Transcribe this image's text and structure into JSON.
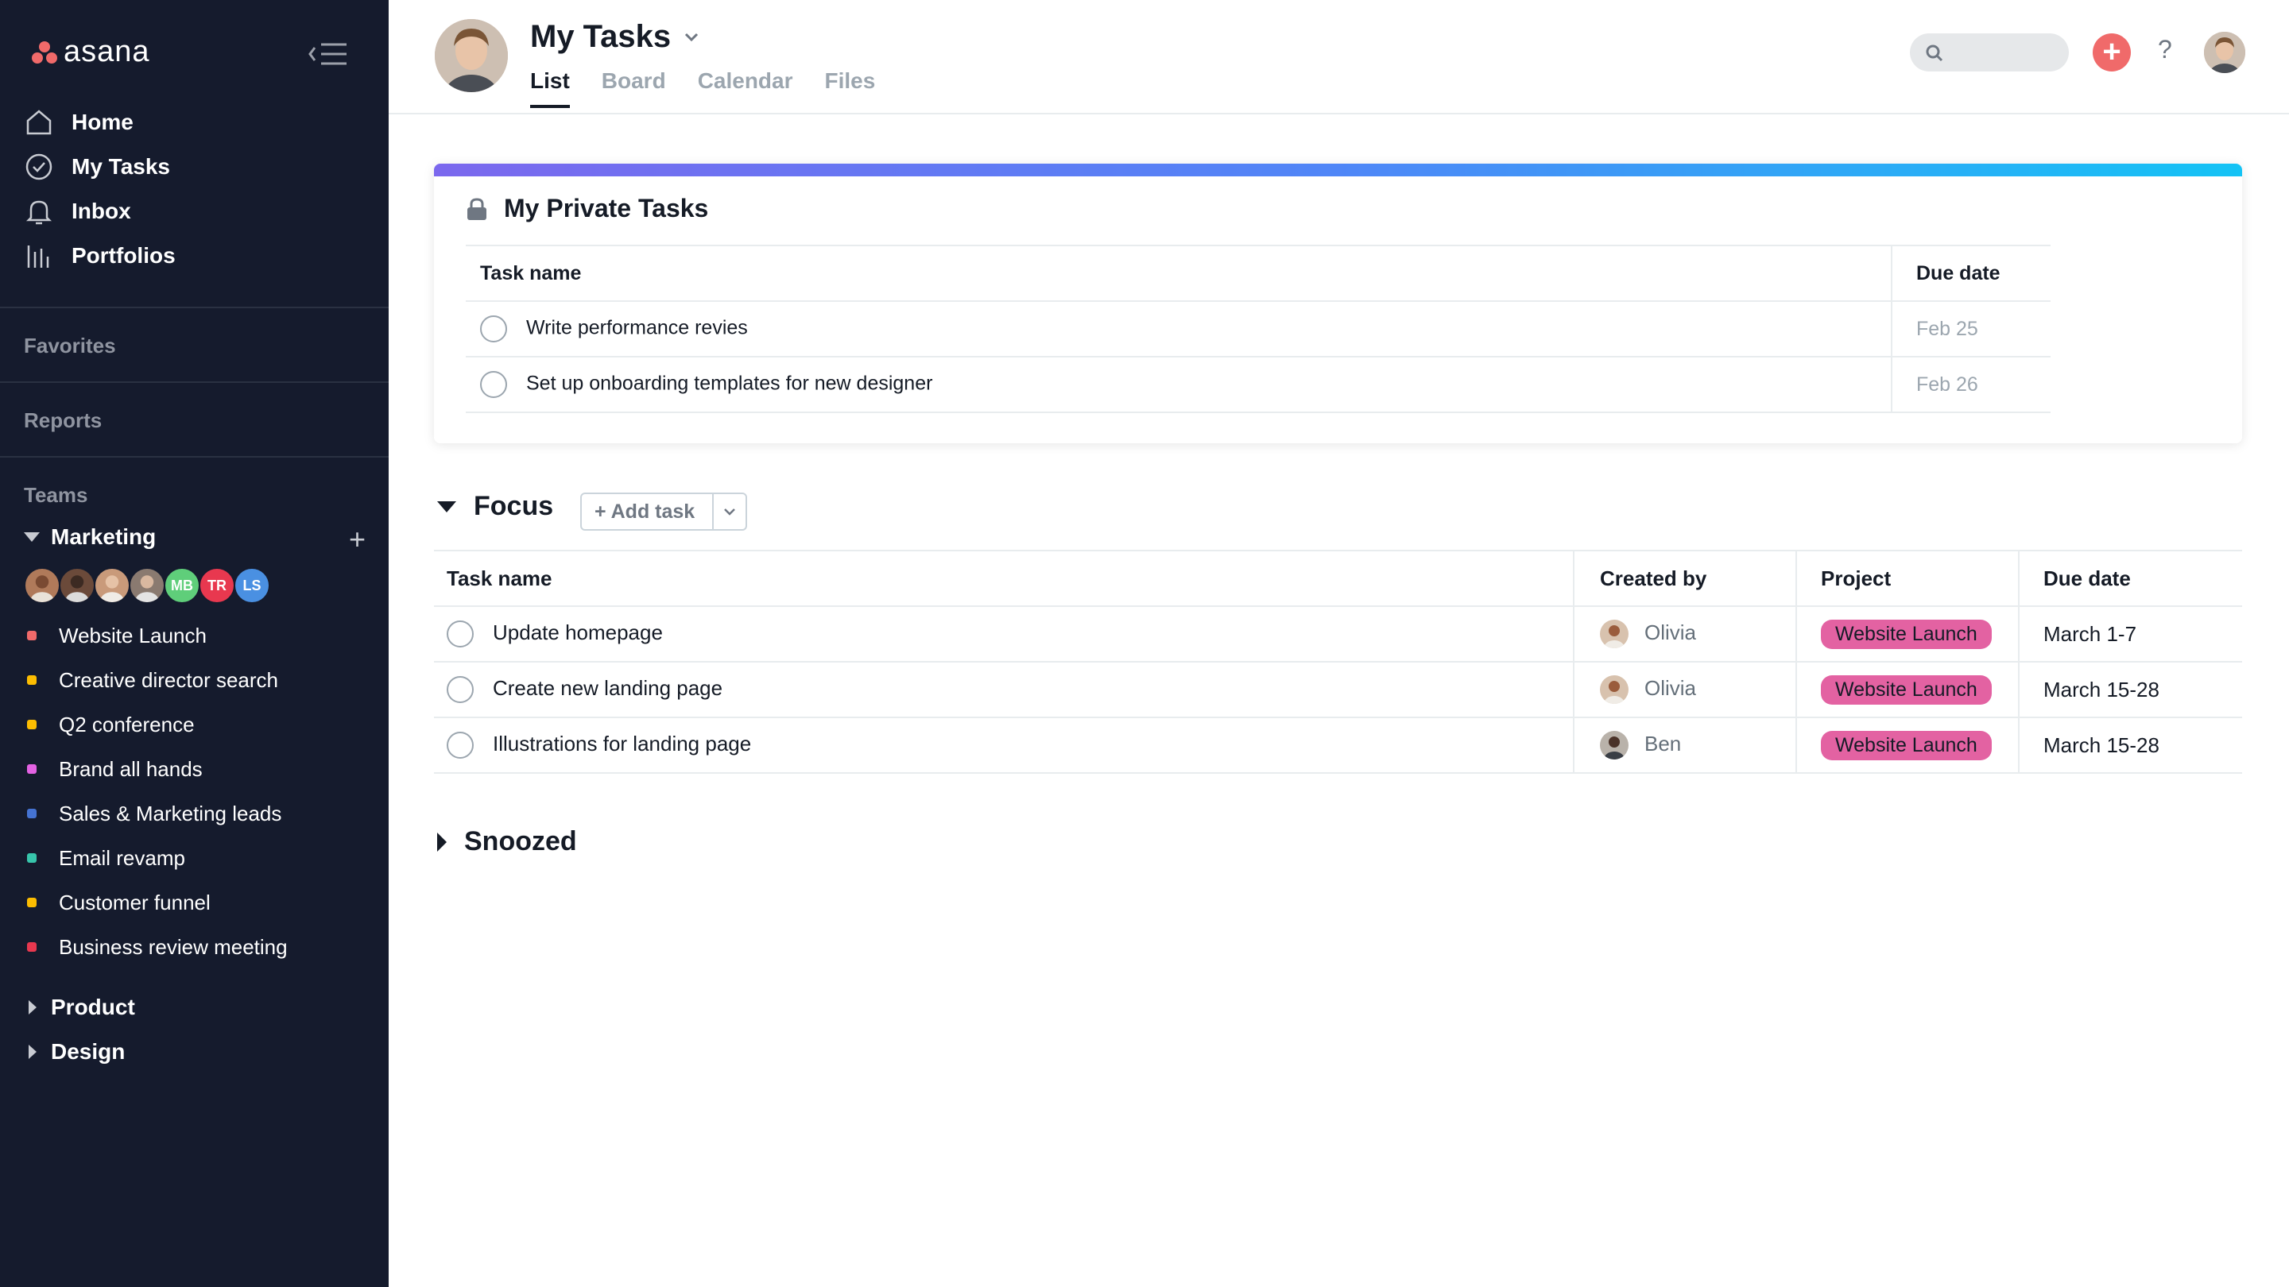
{
  "app": {
    "brand": "asana"
  },
  "sidebar": {
    "nav": [
      {
        "label": "Home",
        "icon": "home-icon"
      },
      {
        "label": "My Tasks",
        "icon": "check-circle-icon"
      },
      {
        "label": "Inbox",
        "icon": "bell-icon"
      },
      {
        "label": "Portfolios",
        "icon": "bar-chart-icon"
      }
    ],
    "favorites_label": "Favorites",
    "reports_label": "Reports",
    "teams_label": "Teams",
    "team": {
      "name": "Marketing",
      "members": [
        {
          "initials": "",
          "color": "#b07a5a"
        },
        {
          "initials": "",
          "color": "#6b4a3a"
        },
        {
          "initials": "",
          "color": "#c99a7a"
        },
        {
          "initials": "",
          "color": "#8a7a70"
        },
        {
          "initials": "MB",
          "color": "#5fce7a"
        },
        {
          "initials": "TR",
          "color": "#e8384f"
        },
        {
          "initials": "LS",
          "color": "#4a90e2"
        }
      ],
      "projects": [
        {
          "label": "Website Launch",
          "color": "#f06a6a"
        },
        {
          "label": "Creative director search",
          "color": "#fcbd01"
        },
        {
          "label": "Q2 conference",
          "color": "#fcbd01"
        },
        {
          "label": "Brand all hands",
          "color": "#e362e3"
        },
        {
          "label": "Sales & Marketing leads",
          "color": "#4573d2"
        },
        {
          "label": "Email revamp",
          "color": "#37c5ab"
        },
        {
          "label": "Customer funnel",
          "color": "#fcbd01"
        },
        {
          "label": "Business review meeting",
          "color": "#e8384f"
        }
      ]
    },
    "other_teams": [
      "Product",
      "Design"
    ]
  },
  "header": {
    "title": "My Tasks",
    "tabs": [
      "List",
      "Board",
      "Calendar",
      "Files"
    ],
    "active_tab": "List",
    "help": "?"
  },
  "private_tasks": {
    "title": "My Private Tasks",
    "columns": [
      "Task name",
      "Due date"
    ],
    "rows": [
      {
        "name": "Write performance revies",
        "due": "Feb 25"
      },
      {
        "name": "Set up onboarding templates for new designer",
        "due": "Feb 26"
      }
    ]
  },
  "focus": {
    "title": "Focus",
    "add_task_label": "+ Add task",
    "columns": [
      "Task name",
      "Created by",
      "Project",
      "Due date"
    ],
    "rows": [
      {
        "name": "Update homepage",
        "creator": "Olivia",
        "project": "Website Launch",
        "due": "March 1-7"
      },
      {
        "name": "Create new landing page",
        "creator": "Olivia",
        "project": "Website Launch",
        "due": "March 15-28"
      },
      {
        "name": "Illustrations for landing page",
        "creator": "Ben",
        "project": "Website Launch",
        "due": "March 15-28"
      }
    ]
  },
  "snoozed": {
    "title": "Snoozed"
  },
  "colors": {
    "sidebar_bg": "#151b2d",
    "accent": "#f06a6a",
    "project_pill": "#e362a2"
  }
}
